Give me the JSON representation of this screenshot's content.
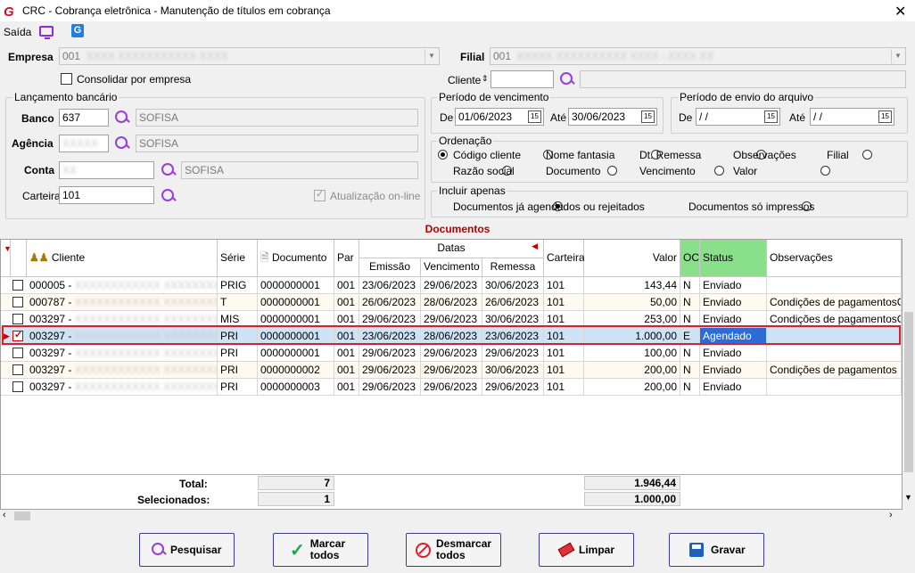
{
  "window": {
    "title": "CRC - Cobrança eletrônica - Manutenção de títulos em cobrança",
    "close_glyph": "✕"
  },
  "menu": {
    "saida": "Saída"
  },
  "empresa": {
    "label": "Empresa",
    "value": "001",
    "consolidar_label": "Consolidar por empresa"
  },
  "filial": {
    "label": "Filial",
    "value": "001"
  },
  "cliente": {
    "label": "Cliente",
    "value": ""
  },
  "lancamento": {
    "title": "Lançamento bancário",
    "banco_label": "Banco",
    "banco_value": "637",
    "banco_name": "SOFISA",
    "agencia_label": "Agência",
    "agencia_name": "SOFISA",
    "conta_label": "Conta",
    "conta_name": "SOFISA",
    "carteira_label": "Carteira",
    "carteira_value": "101",
    "atualizacao_label": "Atualização on-line"
  },
  "vencimento": {
    "title": "Período de vencimento",
    "de_label": "De",
    "de_value": "01/06/2023",
    "ate_label": "Até",
    "ate_value": "30/06/2023"
  },
  "envio": {
    "title": "Período de envio do arquivo",
    "de_label": "De",
    "de_value": "/ /",
    "ate_label": "Até",
    "ate_value": "/ /"
  },
  "ordenacao": {
    "title": "Ordenação",
    "options": [
      "Código cliente",
      "Nome fantasia",
      "Dt. Remessa",
      "Observações",
      "Filial",
      "Razão social",
      "Documento",
      "Vencimento",
      "Valor"
    ],
    "selected": "Código cliente"
  },
  "incluir": {
    "title": "Incluir apenas",
    "options": [
      "Documentos já agendados ou rejeitados",
      "Documentos só impressos"
    ],
    "selected": "Documentos já agendados ou rejeitados"
  },
  "documentos": {
    "title": "Documentos",
    "headers": {
      "cliente": "Cliente",
      "serie": "Série",
      "documento": "Documento",
      "par": "Par",
      "datas": "Datas",
      "emissao": "Emissão",
      "vencimento": "Vencimento",
      "remessa": "Remessa",
      "carteira": "Carteira",
      "valor": "Valor",
      "oc": "OC",
      "status": "Status",
      "observacoes": "Observações"
    },
    "rows": [
      {
        "cliente": "000005 -",
        "serie": "PRIG",
        "documento": "0000000001",
        "par": "001",
        "emissao": "23/06/2023",
        "vencimento": "29/06/2023",
        "remessa": "30/06/2023",
        "carteira": "101",
        "valor": "143,44",
        "oc": "N",
        "status": "Enviado",
        "obs": "",
        "checked": false
      },
      {
        "cliente": "000787 -",
        "serie": "T",
        "documento": "0000000001",
        "par": "001",
        "emissao": "26/06/2023",
        "vencimento": "28/06/2023",
        "remessa": "26/06/2023",
        "carteira": "101",
        "valor": "50,00",
        "oc": "N",
        "status": "Enviado",
        "obs": "Condições de pagamentosCo",
        "checked": false
      },
      {
        "cliente": "003297 -",
        "serie": "MIS",
        "documento": "0000000001",
        "par": "001",
        "emissao": "29/06/2023",
        "vencimento": "29/06/2023",
        "remessa": "30/06/2023",
        "carteira": "101",
        "valor": "253,00",
        "oc": "N",
        "status": "Enviado",
        "obs": "Condições de pagamentosCo",
        "checked": false
      },
      {
        "cliente": "003297 -",
        "serie": "PRI",
        "documento": "0000000001",
        "par": "001",
        "emissao": "23/06/2023",
        "vencimento": "28/06/2023",
        "remessa": "23/06/2023",
        "carteira": "101",
        "valor": "1.000,00",
        "oc": "E",
        "status": "Agendado",
        "obs": "",
        "checked": true
      },
      {
        "cliente": "003297 -",
        "serie": "PRI",
        "documento": "0000000001",
        "par": "001",
        "emissao": "29/06/2023",
        "vencimento": "29/06/2023",
        "remessa": "29/06/2023",
        "carteira": "101",
        "valor": "100,00",
        "oc": "N",
        "status": "Enviado",
        "obs": "",
        "checked": false
      },
      {
        "cliente": "003297 -",
        "serie": "PRI",
        "documento": "0000000002",
        "par": "001",
        "emissao": "29/06/2023",
        "vencimento": "29/06/2023",
        "remessa": "30/06/2023",
        "carteira": "101",
        "valor": "200,00",
        "oc": "N",
        "status": "Enviado",
        "obs": "Condições de pagamentos",
        "checked": false
      },
      {
        "cliente": "003297 -",
        "serie": "PRI",
        "documento": "0000000003",
        "par": "001",
        "emissao": "29/06/2023",
        "vencimento": "29/06/2023",
        "remessa": "29/06/2023",
        "carteira": "101",
        "valor": "200,00",
        "oc": "N",
        "status": "Enviado",
        "obs": "",
        "checked": false
      }
    ],
    "total_label": "Total:",
    "total_count": "7",
    "total_value": "1.946,44",
    "sel_label": "Selecionados:",
    "sel_count": "1",
    "sel_value": "1.000,00"
  },
  "buttons": {
    "pesquisar": "Pesquisar",
    "marcar_1": "Marcar",
    "marcar_2": "todos",
    "desmarcar_1": "Desmarcar",
    "desmarcar_2": "todos",
    "limpar": "Limpar",
    "gravar": "Gravar"
  },
  "colors": {
    "accent": "#c8102e",
    "highlight_row": "#cfe3f7",
    "status_highlight": "#2b6cd6",
    "header_green": "#8ae08a"
  }
}
